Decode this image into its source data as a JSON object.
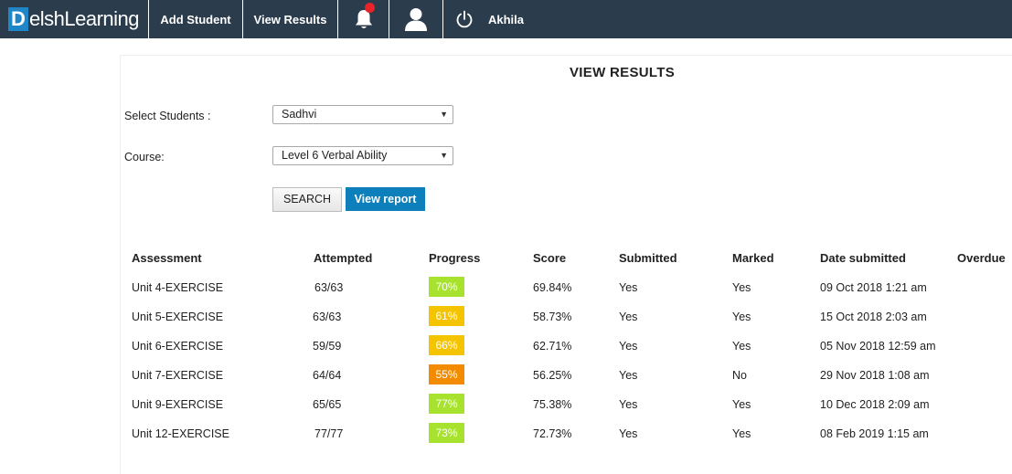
{
  "nav": {
    "brand_initial": "D",
    "brand_rest": "elshLearning",
    "add_student": "Add Student",
    "view_results": "View Results",
    "user_name": "Akhila"
  },
  "page": {
    "title": "VIEW RESULTS"
  },
  "filters": {
    "student_label": "Select Students :",
    "student_value": "Sadhvi",
    "course_label": "Course:",
    "course_value": "Level 6 Verbal Ability",
    "search_label": "SEARCH",
    "report_label": "View report"
  },
  "table": {
    "headers": {
      "assessment": "Assessment",
      "attempted": "Attempted",
      "progress": "Progress",
      "score": "Score",
      "submitted": "Submitted",
      "marked": "Marked",
      "date": "Date submitted",
      "overdue": "Overdue"
    },
    "rows": [
      {
        "assessment": "Unit 4-EXERCISE",
        "attempted": "63/63",
        "progress": "70%",
        "progress_color": "#a6e22e",
        "score": "69.84%",
        "submitted": "Yes",
        "marked": "Yes",
        "date": "09 Oct 2018 1:21 am"
      },
      {
        "assessment": "Unit 5-EXERCISE",
        "attempted": "63/63",
        "progress": "61%",
        "progress_color": "#f5c400",
        "score": "58.73%",
        "submitted": "Yes",
        "marked": "Yes",
        "date": "15 Oct 2018 2:03 am"
      },
      {
        "assessment": "Unit 6-EXERCISE",
        "attempted": "59/59",
        "progress": "66%",
        "progress_color": "#f5c400",
        "score": "62.71%",
        "submitted": "Yes",
        "marked": "Yes",
        "date": "05 Nov 2018 12:59 am"
      },
      {
        "assessment": "Unit 7-EXERCISE",
        "attempted": "64/64",
        "progress": "55%",
        "progress_color": "#f28b00",
        "score": "56.25%",
        "submitted": "Yes",
        "marked": "No",
        "date": "29 Nov 2018 1:08 am"
      },
      {
        "assessment": "Unit 9-EXERCISE",
        "attempted": "65/65",
        "progress": "77%",
        "progress_color": "#a6e22e",
        "score": "75.38%",
        "submitted": "Yes",
        "marked": "Yes",
        "date": "10 Dec 2018 2:09 am"
      },
      {
        "assessment": "Unit 12-EXERCISE",
        "attempted": "77/77",
        "progress": "73%",
        "progress_color": "#a6e22e",
        "score": "72.73%",
        "submitted": "Yes",
        "marked": "Yes",
        "date": "08 Feb 2019 1:15 am"
      }
    ]
  },
  "colors": {
    "nav_bg": "#2b3d4d",
    "brand_blue": "#1f86c7",
    "report_button": "#0d7fbb",
    "notification_dot": "#e8242a"
  },
  "icons": {
    "bell": "bell-icon",
    "user": "user-icon",
    "power": "power-icon",
    "caret": "caret-down-icon"
  }
}
